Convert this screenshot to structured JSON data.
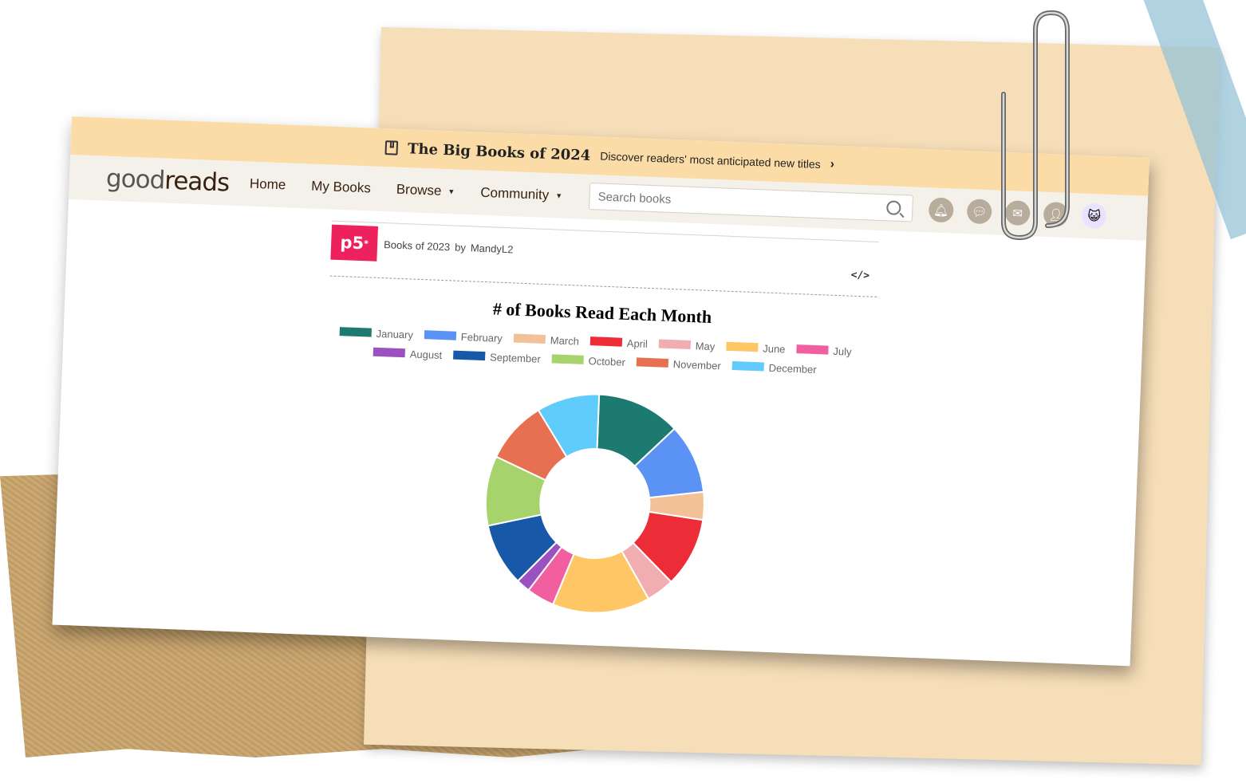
{
  "banner": {
    "title": "The Big Books of 2024",
    "subtitle": "Discover readers' most anticipated new titles",
    "chevron": "›",
    "icon": "bookmark-book-icon"
  },
  "nav": {
    "logo_light": "good",
    "logo_bold": "reads",
    "links": [
      {
        "label": "Home"
      },
      {
        "label": "My Books"
      },
      {
        "label": "Browse",
        "caret": "▼"
      },
      {
        "label": "Community",
        "caret": "▼"
      }
    ],
    "search_placeholder": "Search books",
    "icons": [
      "bell-icon",
      "chat-icon",
      "mail-icon",
      "friends-icon",
      "avatar-icon"
    ]
  },
  "p5": {
    "logo": "p5",
    "logo_star": "*",
    "sketch_title": "Books of 2023",
    "by": "by",
    "author": "MandyL2",
    "code_label": "</>"
  },
  "chart_data": {
    "type": "pie",
    "title": "# of Books Read Each Month",
    "legend_position": "top",
    "categories": [
      "January",
      "February",
      "March",
      "April",
      "May",
      "June",
      "July",
      "August",
      "September",
      "October",
      "November",
      "December"
    ],
    "values": [
      12,
      10,
      4,
      10,
      4,
      14,
      4,
      2,
      9,
      10,
      9,
      9
    ],
    "colors": [
      "#1d7a71",
      "#5b93f5",
      "#f3c198",
      "#ec2c36",
      "#f0aeb0",
      "#fec665",
      "#f15fa0",
      "#9b52c0",
      "#1758a8",
      "#a6d36c",
      "#e77052",
      "#60ccfb"
    ],
    "donut_hole_fraction": 0.5
  }
}
